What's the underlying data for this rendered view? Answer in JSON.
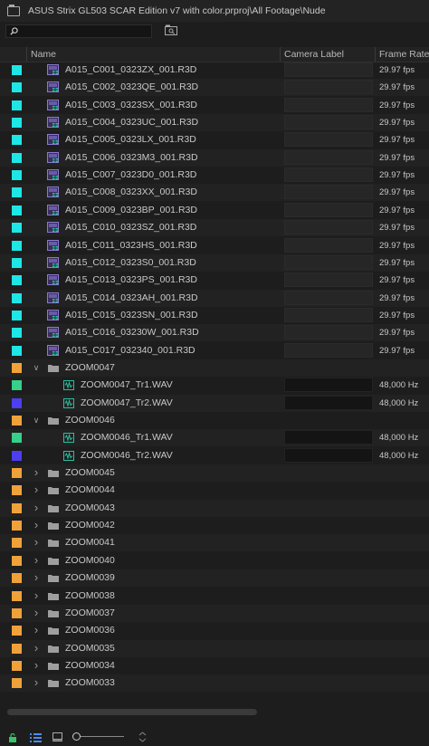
{
  "title": "ASUS Strix GL503 SCAR Edition v7 with color.prproj\\All Footage\\Nude",
  "search": {
    "value": "",
    "placeholder": ""
  },
  "columns": {
    "name": "Name",
    "camera_label": "Camera Label",
    "frame_rate": "Frame Rate"
  },
  "colors": {
    "cyan": "#1fe6e6",
    "orange": "#f0a23a",
    "green": "#36d08a",
    "blue": "#4b3ff0"
  },
  "rows": [
    {
      "type": "clip",
      "color": "#1fe6e6",
      "name": "A015_C001_0323ZX_001.R3D",
      "rate": "29.97 fps"
    },
    {
      "type": "clip",
      "color": "#1fe6e6",
      "name": "A015_C002_0323QE_001.R3D",
      "rate": "29.97 fps"
    },
    {
      "type": "clip",
      "color": "#1fe6e6",
      "name": "A015_C003_0323SX_001.R3D",
      "rate": "29.97 fps"
    },
    {
      "type": "clip",
      "color": "#1fe6e6",
      "name": "A015_C004_0323UC_001.R3D",
      "rate": "29.97 fps"
    },
    {
      "type": "clip",
      "color": "#1fe6e6",
      "name": "A015_C005_0323LX_001.R3D",
      "rate": "29.97 fps"
    },
    {
      "type": "clip",
      "color": "#1fe6e6",
      "name": "A015_C006_0323M3_001.R3D",
      "rate": "29.97 fps"
    },
    {
      "type": "clip",
      "color": "#1fe6e6",
      "name": "A015_C007_0323D0_001.R3D",
      "rate": "29.97 fps"
    },
    {
      "type": "clip",
      "color": "#1fe6e6",
      "name": "A015_C008_0323XX_001.R3D",
      "rate": "29.97 fps"
    },
    {
      "type": "clip",
      "color": "#1fe6e6",
      "name": "A015_C009_0323BP_001.R3D",
      "rate": "29.97 fps"
    },
    {
      "type": "clip",
      "color": "#1fe6e6",
      "name": "A015_C010_0323SZ_001.R3D",
      "rate": "29.97 fps"
    },
    {
      "type": "clip",
      "color": "#1fe6e6",
      "name": "A015_C011_0323HS_001.R3D",
      "rate": "29.97 fps"
    },
    {
      "type": "clip",
      "color": "#1fe6e6",
      "name": "A015_C012_0323S0_001.R3D",
      "rate": "29.97 fps"
    },
    {
      "type": "clip",
      "color": "#1fe6e6",
      "name": "A015_C013_0323PS_001.R3D",
      "rate": "29.97 fps"
    },
    {
      "type": "clip",
      "color": "#1fe6e6",
      "name": "A015_C014_0323AH_001.R3D",
      "rate": "29.97 fps"
    },
    {
      "type": "clip",
      "color": "#1fe6e6",
      "name": "A015_C015_0323SN_001.R3D",
      "rate": "29.97 fps"
    },
    {
      "type": "clip",
      "color": "#1fe6e6",
      "name": "A015_C016_03230W_001.R3D",
      "rate": "29.97 fps"
    },
    {
      "type": "clip",
      "color": "#1fe6e6",
      "name": "A015_C017_032340_001.R3D",
      "rate": "29.97 fps"
    },
    {
      "type": "folder-open",
      "color": "#f0a23a",
      "name": "ZOOM0047",
      "rate": ""
    },
    {
      "type": "audio",
      "color": "#36d08a",
      "name": "ZOOM0047_Tr1.WAV",
      "rate": "48,000 Hz"
    },
    {
      "type": "audio",
      "color": "#4b3ff0",
      "name": "ZOOM0047_Tr2.WAV",
      "rate": "48,000 Hz"
    },
    {
      "type": "folder-open",
      "color": "#f0a23a",
      "name": "ZOOM0046",
      "rate": ""
    },
    {
      "type": "audio",
      "color": "#36d08a",
      "name": "ZOOM0046_Tr1.WAV",
      "rate": "48,000 Hz"
    },
    {
      "type": "audio",
      "color": "#4b3ff0",
      "name": "ZOOM0046_Tr2.WAV",
      "rate": "48,000 Hz"
    },
    {
      "type": "folder",
      "color": "#f0a23a",
      "name": "ZOOM0045",
      "rate": ""
    },
    {
      "type": "folder",
      "color": "#f0a23a",
      "name": "ZOOM0044",
      "rate": ""
    },
    {
      "type": "folder",
      "color": "#f0a23a",
      "name": "ZOOM0043",
      "rate": ""
    },
    {
      "type": "folder",
      "color": "#f0a23a",
      "name": "ZOOM0042",
      "rate": ""
    },
    {
      "type": "folder",
      "color": "#f0a23a",
      "name": "ZOOM0041",
      "rate": ""
    },
    {
      "type": "folder",
      "color": "#f0a23a",
      "name": "ZOOM0040",
      "rate": ""
    },
    {
      "type": "folder",
      "color": "#f0a23a",
      "name": "ZOOM0039",
      "rate": ""
    },
    {
      "type": "folder",
      "color": "#f0a23a",
      "name": "ZOOM0038",
      "rate": ""
    },
    {
      "type": "folder",
      "color": "#f0a23a",
      "name": "ZOOM0037",
      "rate": ""
    },
    {
      "type": "folder",
      "color": "#f0a23a",
      "name": "ZOOM0036",
      "rate": ""
    },
    {
      "type": "folder",
      "color": "#f0a23a",
      "name": "ZOOM0035",
      "rate": ""
    },
    {
      "type": "folder",
      "color": "#f0a23a",
      "name": "ZOOM0034",
      "rate": ""
    },
    {
      "type": "folder",
      "color": "#f0a23a",
      "name": "ZOOM0033",
      "rate": ""
    }
  ],
  "footer": {
    "icons": [
      "lock-icon",
      "list-view-icon",
      "icon-view-icon",
      "zoom-slider",
      "sort-icon"
    ]
  }
}
